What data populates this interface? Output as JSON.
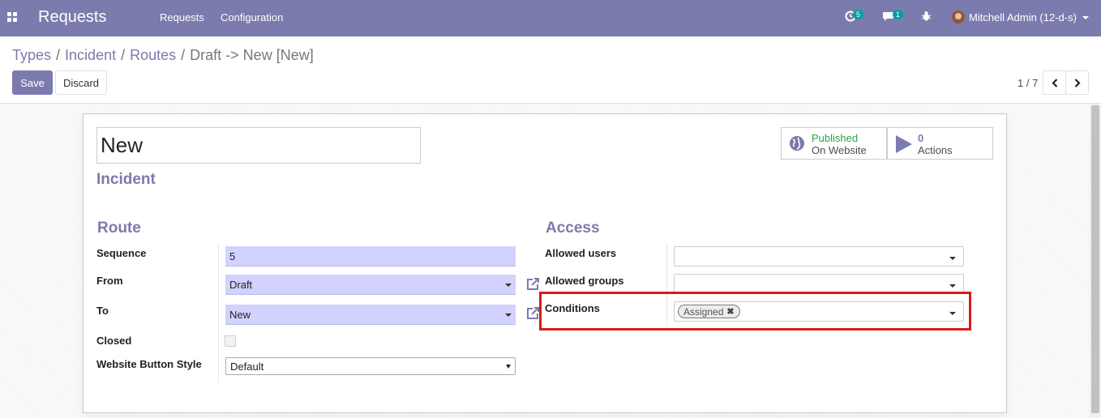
{
  "navbar": {
    "app_name": "Requests",
    "menu": [
      "Requests",
      "Configuration"
    ],
    "activity_count": "5",
    "message_count": "1",
    "user": "Mitchell Admin (12-d-s)",
    "bg_color": "#7c7bad"
  },
  "breadcrumb": {
    "items": [
      "Types",
      "Incident",
      "Routes"
    ],
    "current": "Draft -> New [New]"
  },
  "buttons": {
    "save": "Save",
    "discard": "Discard"
  },
  "pager": {
    "value": "1 / 7"
  },
  "form": {
    "name": "New",
    "type": "Incident",
    "stat_buttons": [
      {
        "icon": "globe-icon",
        "line1": "Published",
        "line2": "On Website",
        "line1_color": "#28a745"
      },
      {
        "icon": "play-icon",
        "line1": "0",
        "line2": "Actions"
      }
    ],
    "route": {
      "title": "Route",
      "sequence_label": "Sequence",
      "sequence_value": "5",
      "from_label": "From",
      "from_value": "Draft",
      "to_label": "To",
      "to_value": "New",
      "closed_label": "Closed",
      "closed_value": false,
      "style_label": "Website Button Style",
      "style_value": "Default"
    },
    "access": {
      "title": "Access",
      "allowed_users_label": "Allowed users",
      "allowed_users_value": "",
      "allowed_groups_label": "Allowed groups",
      "allowed_groups_value": "",
      "conditions_label": "Conditions",
      "conditions_tags": [
        "Assigned"
      ]
    }
  },
  "highlight_color": "#d81b1b"
}
